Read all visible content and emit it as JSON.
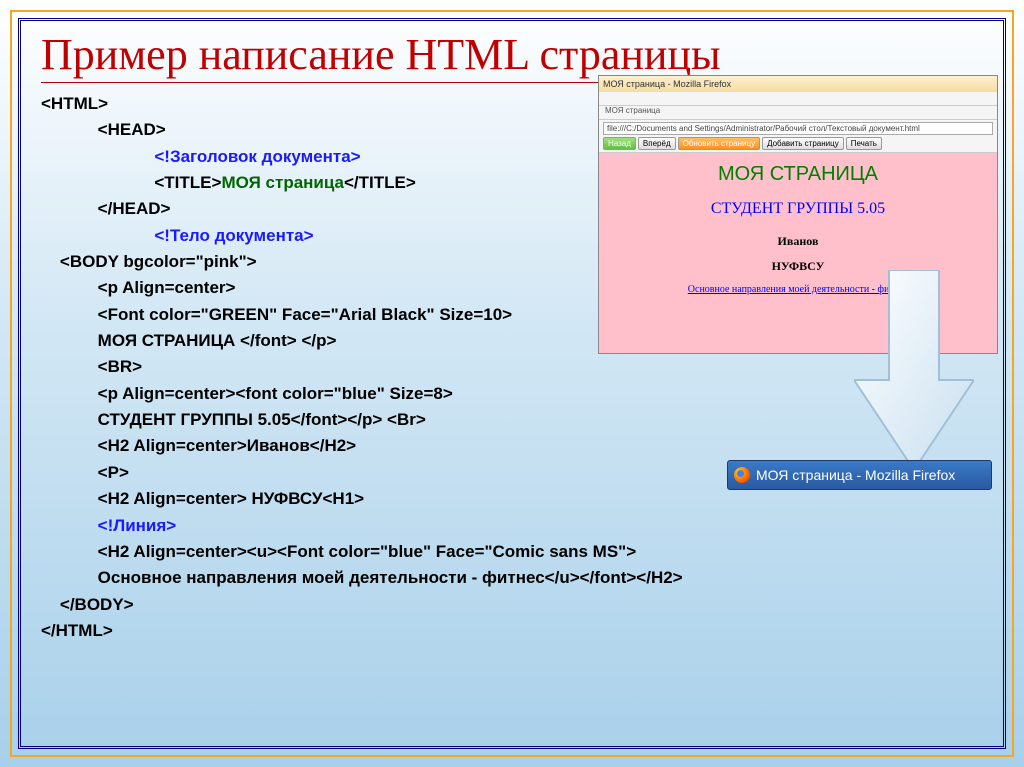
{
  "slide": {
    "title": "Пример написание HTML страницы"
  },
  "code": {
    "l01": "<HTML>",
    "l02": "            <HEAD>",
    "l03": "                        <!Заголовок документа>",
    "l04_a": "                        <TITLE>",
    "l04_b": "МОЯ страница",
    "l04_c": "</TITLE>",
    "l05": "            </HEAD>",
    "l06": "                        <!Тело документа>",
    "l07": "    <BODY bgcolor=\"pink\">",
    "l08": "            <p Align=center>",
    "l09": "            <Font color=\"GREEN\" Face=\"Arial Black\" Size=10>",
    "l10": "            МОЯ СТРАНИЦА </font> </p>",
    "l11": "            <BR>",
    "l12": "            <p Align=center><font color=\"blue\" Size=8>",
    "l13": "            СТУДЕНТ ГРУППЫ 5.05</font></p> <Br>",
    "l14": "            <H2 Align=center>Иванов</H2>",
    "l15": "            <P>",
    "l16": "            <H2 Align=center> НУФВСУ<H1>",
    "l17": "            <!Линия>",
    "l18": "            <H2 Align=center><u><Font color=\"blue\" Face=\"Comic sans MS\">",
    "l19": "            Основное направления моей деятельности - фитнес</u></font></H2>",
    "l20": "    </BODY>",
    "l21": "</HTML>"
  },
  "preview": {
    "window_title": "МОЯ страница - Mozilla Firefox",
    "tab_label": "МОЯ страница",
    "address": "file:///C:/Documents and Settings/Administrator/Рабочий стол/Текстовый документ.html",
    "btn1": "Назад",
    "btn2": "Вперёд",
    "btn3": "Обновить страницу",
    "btn4": "Добавить страницу",
    "btn5": "Печать",
    "h1": "МОЯ СТРАНИЦА",
    "h2": "СТУДЕНТ ГРУППЫ 5.05",
    "name": "Иванов",
    "univ": "НУФВСУ",
    "link": "Основное направления моей деятельности - фитнес"
  },
  "taskbar": {
    "text": "МОЯ страница - Mozilla Firefox"
  }
}
